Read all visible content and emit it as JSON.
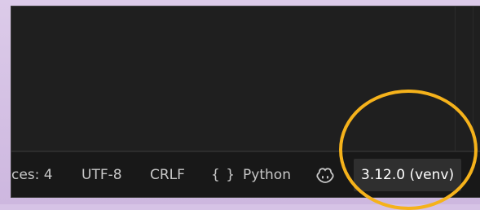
{
  "status_bar": {
    "spaces_label": "ces: 4",
    "encoding_label": "UTF-8",
    "eol_label": "CRLF",
    "language_braces": "{ }",
    "language_label": "Python",
    "copilot_icon": "copilot-icon",
    "interpreter_label": "3.12.0 (venv)"
  },
  "annotation": {
    "highlight_color": "#f5b21b"
  },
  "colors": {
    "editor_bg": "#1f1f1f",
    "statusbar_bg": "#181818",
    "statusbar_text": "#cccccc",
    "frame_bg": "#d6c3e6"
  }
}
